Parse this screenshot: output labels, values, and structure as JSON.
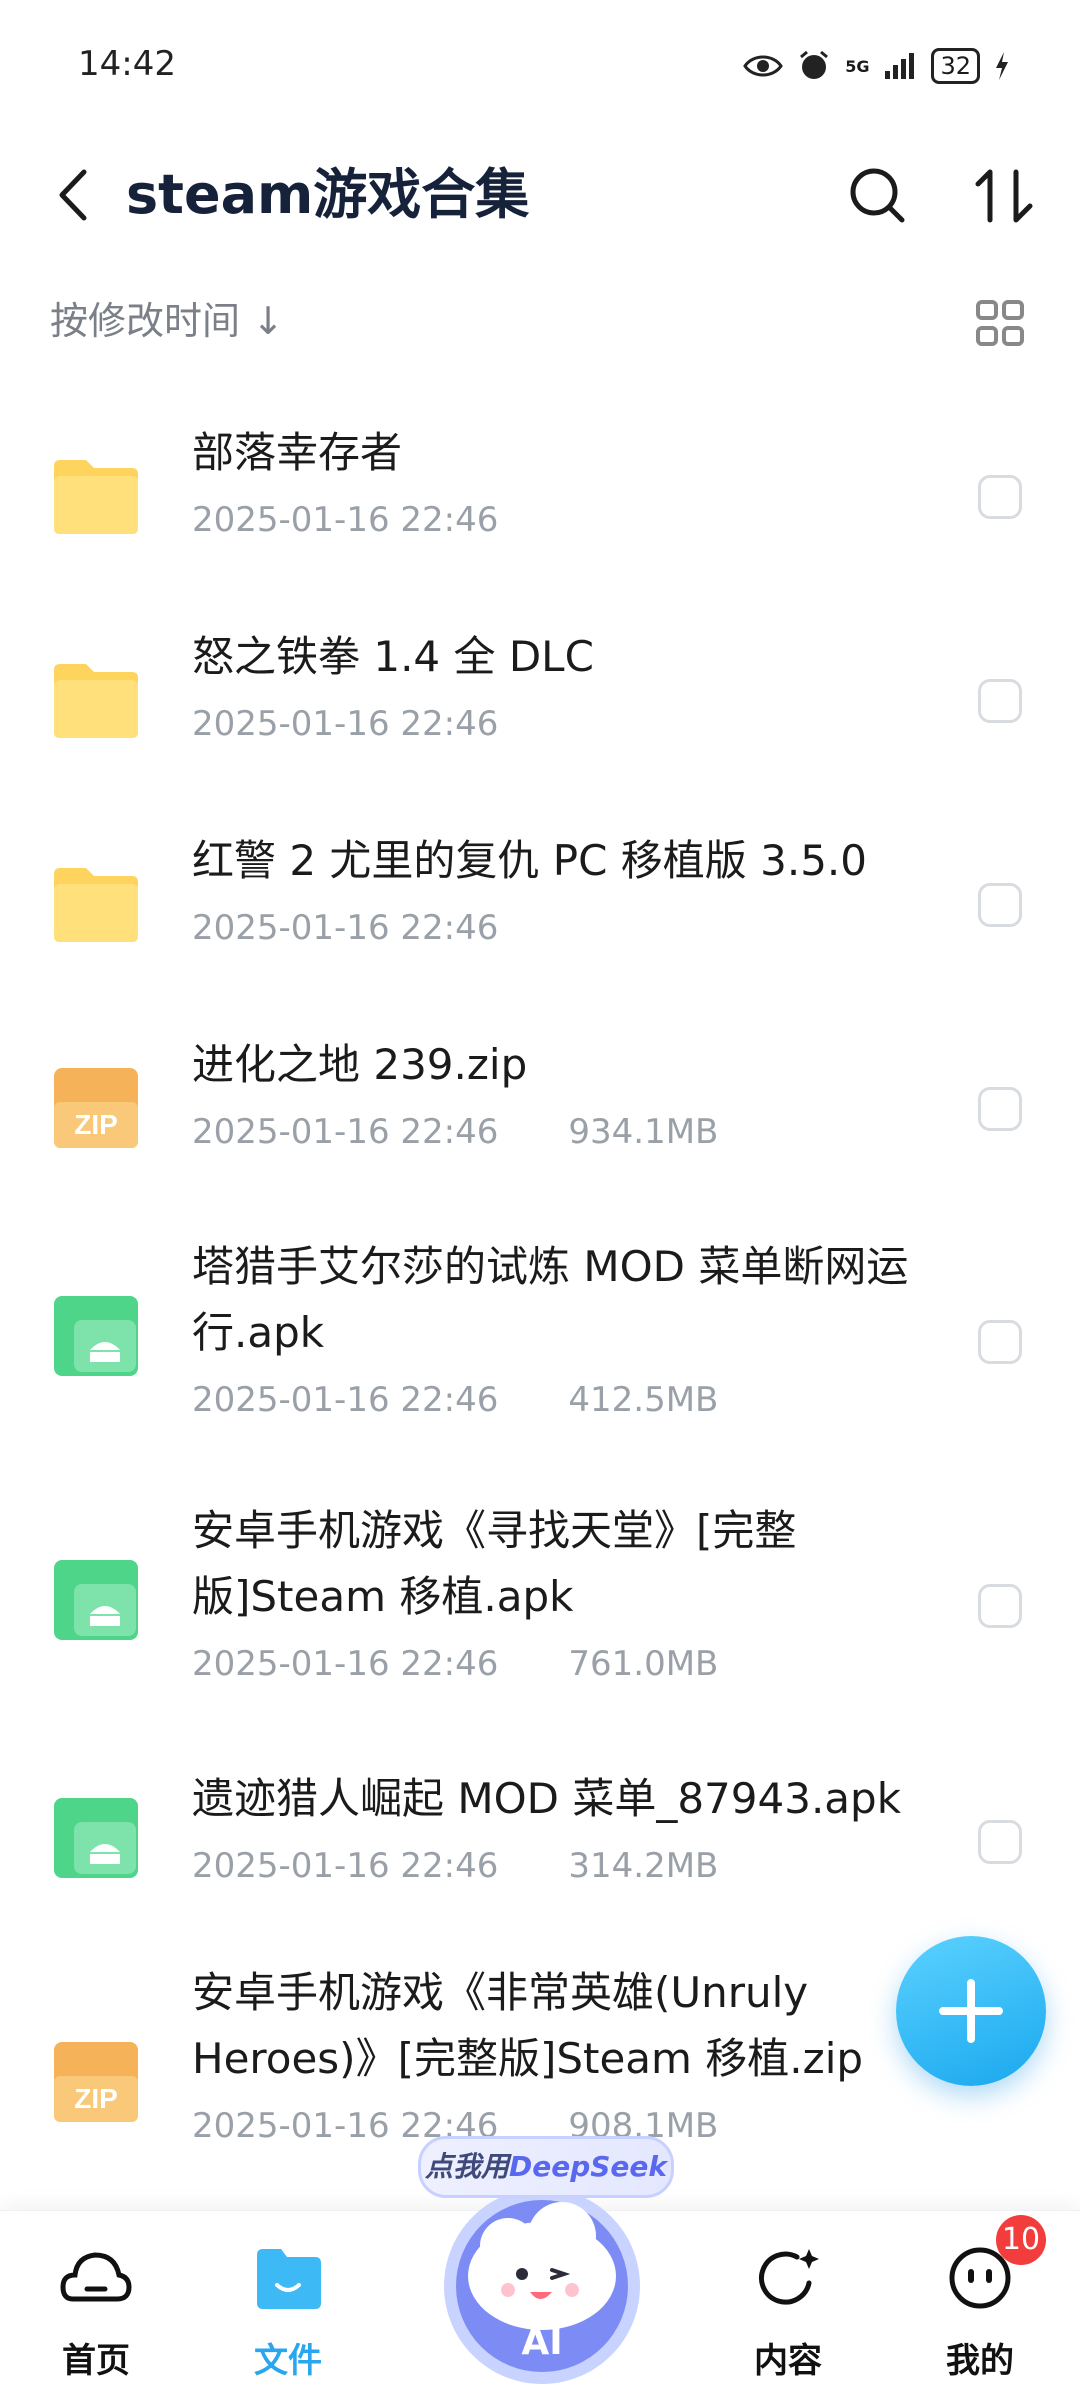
{
  "status": {
    "time": "14:42",
    "network": "5G",
    "battery": "32",
    "icons": [
      "eye-icon",
      "alarm-icon",
      "signal-icon",
      "battery-icon",
      "charging-icon"
    ]
  },
  "header": {
    "title": "steam游戏合集",
    "icons": [
      "back-arrow-icon",
      "search-icon",
      "sort-icon"
    ]
  },
  "sort": {
    "label": "按修改时间 ↓",
    "icon": "grid-view-icon"
  },
  "files": [
    {
      "type": "folder",
      "name": "部落幸存者",
      "date": "2025-01-16 22:46",
      "size": ""
    },
    {
      "type": "folder",
      "name": "怒之铁拳 1.4 全 DLC",
      "date": "2025-01-16 22:46",
      "size": ""
    },
    {
      "type": "folder",
      "name": "红警 2 尤里的复仇 PC 移植版 3.5.0",
      "date": "2025-01-16 22:46",
      "size": ""
    },
    {
      "type": "zip",
      "name": "进化之地 239.zip",
      "date": "2025-01-16 22:46",
      "size": "934.1MB"
    },
    {
      "type": "apk",
      "name": "塔猎手艾尔莎的试炼 MOD 菜单断网运行.apk",
      "date": "2025-01-16 22:46",
      "size": "412.5MB"
    },
    {
      "type": "apk",
      "name": "安卓手机游戏《寻找天堂》[完整版]Steam 移植.apk",
      "date": "2025-01-16 22:46",
      "size": "761.0MB"
    },
    {
      "type": "apk",
      "name": "遗迹猎人崛起 MOD 菜单_87943.apk",
      "date": "2025-01-16 22:46",
      "size": "314.2MB"
    },
    {
      "type": "zip",
      "name": "安卓手机游戏《非常英雄(Unruly Heroes)》[完整版]Steam 移植.zip",
      "date": "2025-01-16 22:46",
      "size": "908.1MB"
    }
  ],
  "zip_badge": "ZIP",
  "fab": {
    "icon": "plus-icon"
  },
  "ai": {
    "pill_prefix": "点我用",
    "pill_brand": "DeepSeek",
    "label": "AI"
  },
  "nav": {
    "items": [
      {
        "label": "首页",
        "icon": "cloud-home-icon",
        "active": false
      },
      {
        "label": "文件",
        "icon": "folder-icon",
        "active": true
      },
      {
        "label": "内容",
        "icon": "refresh-star-icon",
        "active": false
      },
      {
        "label": "我的",
        "icon": "face-icon",
        "active": false,
        "badge": "10"
      }
    ]
  },
  "colors": {
    "accent": "#2aa6ee",
    "folder": "#ffd45e",
    "zip": "#f5b258",
    "apk": "#4fd58a",
    "badge": "#f33d3d"
  }
}
